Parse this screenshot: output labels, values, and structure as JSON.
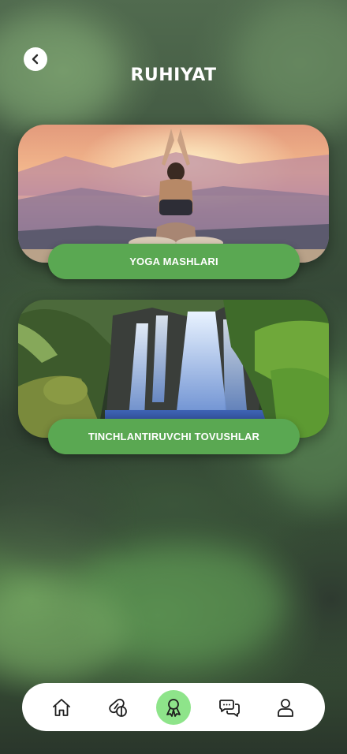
{
  "header": {
    "title": "RUHIYAT"
  },
  "cards": [
    {
      "label": "YOGA MASHLARI",
      "image": "yoga-sunset-photo"
    },
    {
      "label": "TINCHLANTIRUVCHI TOVUSHLAR",
      "image": "waterfall-photo"
    }
  ],
  "nav": {
    "items": [
      {
        "icon": "home-icon"
      },
      {
        "icon": "pills-icon"
      },
      {
        "icon": "award-ribbon-icon",
        "active": true
      },
      {
        "icon": "chat-icon"
      },
      {
        "icon": "user-icon"
      }
    ]
  },
  "colors": {
    "button_green": "#5aa852",
    "active_nav": "#8ee48a"
  }
}
